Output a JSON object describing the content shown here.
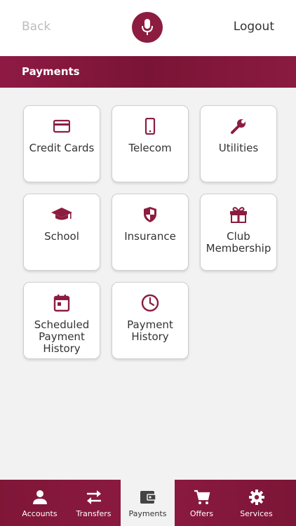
{
  "header": {
    "back_label": "Back",
    "logout_label": "Logout",
    "mic_icon": "microphone-icon"
  },
  "section": {
    "title": "Payments"
  },
  "tiles": [
    {
      "lines": [
        "Credit Cards"
      ],
      "icon": "credit-card-icon"
    },
    {
      "lines": [
        "Telecom"
      ],
      "icon": "mobile-phone-icon"
    },
    {
      "lines": [
        "Utilities"
      ],
      "icon": "wrench-icon"
    },
    {
      "lines": [
        "School"
      ],
      "icon": "graduation-cap-icon"
    },
    {
      "lines": [
        "Insurance"
      ],
      "icon": "shield-icon"
    },
    {
      "lines": [
        "Club",
        "Membership"
      ],
      "icon": "gift-icon"
    },
    {
      "lines": [
        "Scheduled",
        "Payment",
        "History"
      ],
      "icon": "calendar-icon"
    },
    {
      "lines": [
        "Payment",
        "History"
      ],
      "icon": "clock-icon"
    }
  ],
  "nav": {
    "items": [
      {
        "label": "Accounts",
        "icon": "person-icon"
      },
      {
        "label": "Transfers",
        "icon": "arrows-exchange-icon"
      },
      {
        "label": "Payments",
        "icon": "wallet-icon"
      },
      {
        "label": "Offers",
        "icon": "shopping-cart-icon"
      },
      {
        "label": "Services",
        "icon": "gear-icon"
      }
    ],
    "active": "Payments"
  },
  "colors": {
    "brand": "#8c1d40",
    "background": "#f2f2f2",
    "text": "#333333",
    "muted": "#bdbdbd"
  }
}
